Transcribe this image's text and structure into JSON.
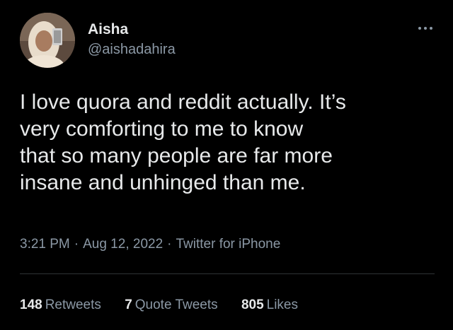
{
  "author": {
    "display_name": "Aisha",
    "handle": "@aishadahira"
  },
  "tweet": {
    "text": "I love quora and reddit actually. It’s\nvery comforting to me to know\nthat so many people are far more\ninsane and unhinged than me.",
    "time": "3:21 PM",
    "date": "Aug 12, 2022",
    "source": "Twitter for iPhone",
    "separator": "·"
  },
  "stats": {
    "retweets": {
      "count": "148",
      "label": "Retweets"
    },
    "quote_tweets": {
      "count": "7",
      "label": "Quote Tweets"
    },
    "likes": {
      "count": "805",
      "label": "Likes"
    }
  },
  "icons": {
    "more": "more-options-icon"
  },
  "colors": {
    "background": "#000000",
    "text_primary": "#e7e9ea",
    "text_secondary": "#8b98a5",
    "divider": "#2f3336"
  }
}
